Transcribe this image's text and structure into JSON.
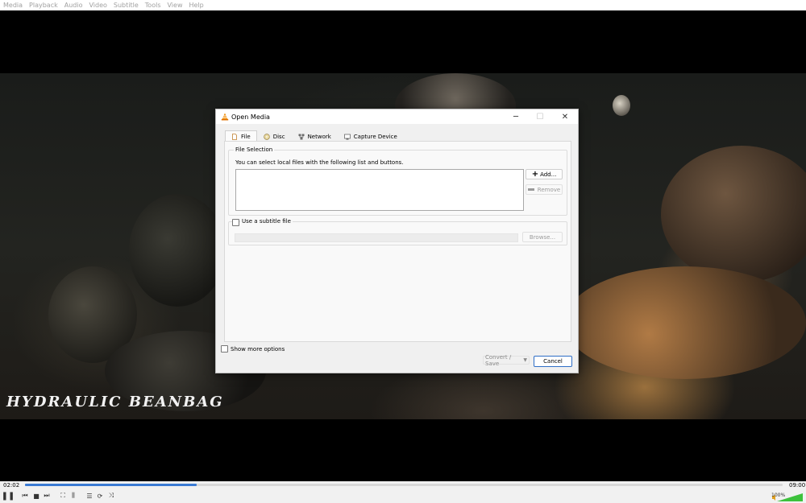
{
  "menu": [
    "Media",
    "Playback",
    "Audio",
    "Video",
    "Subtitle",
    "Tools",
    "View",
    "Help"
  ],
  "video": {
    "caption": "HYDRAULIC BEANBAG"
  },
  "dialog": {
    "title": "Open Media",
    "tabs": [
      {
        "label": "File",
        "icon": "file-icon",
        "active": true
      },
      {
        "label": "Disc",
        "icon": "disc-icon"
      },
      {
        "label": "Network",
        "icon": "network-icon"
      },
      {
        "label": "Capture Device",
        "icon": "capture-device-icon"
      }
    ],
    "file_selection": {
      "title": "File Selection",
      "hint": "You can select local files with the following list and buttons.",
      "add_label": "Add...",
      "remove_label": "Remove"
    },
    "subtitle": {
      "label": "Use a subtitle file",
      "browse_label": "Browse..."
    },
    "show_more": "Show more options",
    "convert_label": "Convert / Save",
    "cancel_label": "Cancel"
  },
  "player": {
    "elapsed": "02:02",
    "total": "09:00",
    "progress": 0.227,
    "volume": "100%",
    "accent": "#3b7bd4"
  }
}
